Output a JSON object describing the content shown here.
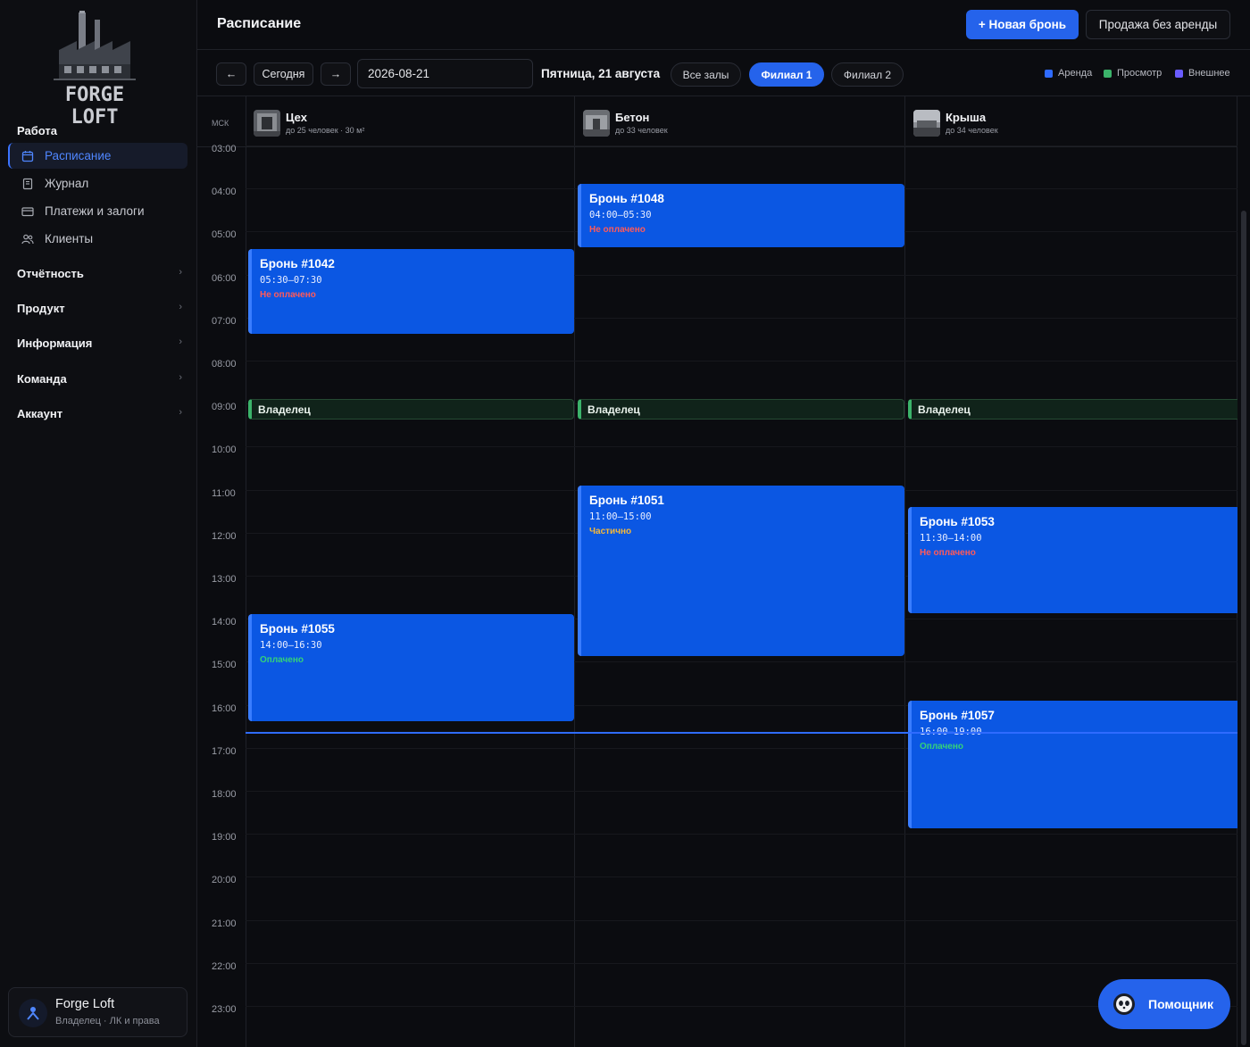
{
  "brand": {
    "name": "FORGE LOFT"
  },
  "sidebar": {
    "section_work": "Работа",
    "items": [
      {
        "label": "Расписание",
        "icon": "calendar-icon",
        "active": true
      },
      {
        "label": "Журнал",
        "icon": "journal-icon",
        "active": false
      },
      {
        "label": "Платежи и залоги",
        "icon": "card-icon",
        "active": false
      },
      {
        "label": "Клиенты",
        "icon": "users-icon",
        "active": false
      }
    ],
    "groups": [
      {
        "label": "Отчётность"
      },
      {
        "label": "Продукт"
      },
      {
        "label": "Информация"
      },
      {
        "label": "Команда"
      },
      {
        "label": "Аккаунт"
      }
    ],
    "chevron": "›",
    "profile": {
      "name": "Forge Loft",
      "role": "Владелец · ЛК и права"
    }
  },
  "header": {
    "title": "Расписание",
    "new_booking": "+ Новая бронь",
    "sale_no_rent": "Продажа без аренды"
  },
  "toolbar": {
    "prev": "←",
    "today": "Сегодня",
    "next": "→",
    "date_value": "2026-08-21",
    "date_label": "Пятница, 21 августа",
    "filters": [
      {
        "label": "Все залы",
        "active": false
      },
      {
        "label": "Филиал 1",
        "active": true
      },
      {
        "label": "Филиал 2",
        "active": false
      }
    ],
    "legend": [
      {
        "label": "Аренда",
        "color": "#2f6bff"
      },
      {
        "label": "Просмотр",
        "color": "#3bb36a"
      },
      {
        "label": "Внешнее",
        "color": "#6a5cff"
      }
    ]
  },
  "calendar": {
    "timezone": "МСК",
    "rooms": [
      {
        "name": "Цех",
        "capacity": "до 25 человек · 30 м²"
      },
      {
        "name": "Бетон",
        "capacity": "до 33 человек"
      },
      {
        "name": "Крыша",
        "capacity": "до 34 человек"
      }
    ],
    "hours": [
      "03:00",
      "04:00",
      "05:00",
      "06:00",
      "07:00",
      "08:00",
      "09:00",
      "10:00",
      "11:00",
      "12:00",
      "13:00",
      "14:00",
      "15:00",
      "16:00",
      "17:00",
      "18:00",
      "19:00",
      "20:00",
      "21:00",
      "22:00",
      "23:00"
    ],
    "events": [
      {
        "room": 0,
        "start": 5.5,
        "end": 7.5,
        "title": "Бронь #1042",
        "time": "05:30–07:30",
        "status": "Не оплачено",
        "status_color": "#ff5a5a"
      },
      {
        "room": 1,
        "start": 4.0,
        "end": 5.5,
        "title": "Бронь #1048",
        "time": "04:00–05:30",
        "status": "Не оплачено",
        "status_color": "#ff5a5a"
      },
      {
        "room": 1,
        "start": 11.0,
        "end": 15.0,
        "title": "Бронь #1051",
        "time": "11:00–15:00",
        "status": "Частично",
        "status_color": "#f5b93a"
      },
      {
        "room": 2,
        "start": 11.5,
        "end": 14.0,
        "title": "Бронь #1053",
        "time": "11:30–14:00",
        "status": "Не оплачено",
        "status_color": "#ff5a5a"
      },
      {
        "room": 0,
        "start": 14.0,
        "end": 16.5,
        "title": "Бронь #1055",
        "time": "14:00–16:30",
        "status": "Оплачено",
        "status_color": "#34d27a"
      },
      {
        "room": 2,
        "start": 16.0,
        "end": 19.0,
        "title": "Бронь #1057",
        "time": "16:00–19:00",
        "status": "Оплачено",
        "status_color": "#34d27a"
      }
    ],
    "owner_label": "Владелец",
    "owner_start": 9.0,
    "now": 16.75
  },
  "assistant": {
    "label": "Помощник"
  }
}
